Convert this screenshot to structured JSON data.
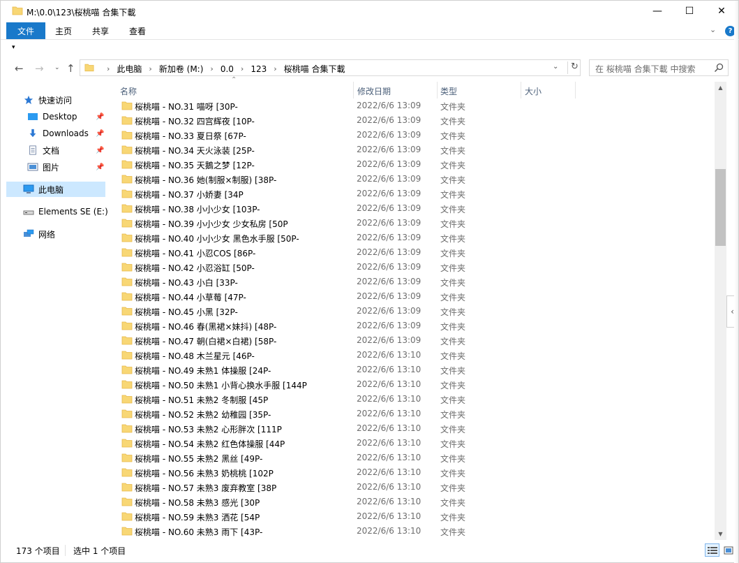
{
  "window": {
    "title": "M:\\0.0\\123\\桜桃喵 合集下載",
    "minimize": "—",
    "maximize": "☐",
    "close": "✕"
  },
  "ribbon": {
    "tabs": [
      "文件",
      "主页",
      "共享",
      "查看"
    ],
    "help": "?",
    "expand": "⌄"
  },
  "qat": {
    "customize": "▾"
  },
  "nav_buttons": {
    "back": "←",
    "forward": "→",
    "recent": "⌄",
    "up": "↑"
  },
  "address": {
    "crumbs": [
      "此电脑",
      "新加卷 (M:)",
      "0.0",
      "123",
      "桜桃喵 合集下載"
    ],
    "separator": "›",
    "dropdown": "⌄",
    "refresh": "↻"
  },
  "search": {
    "placeholder": "在 桜桃喵 合集下載 中搜索"
  },
  "navpane": {
    "quick_access": "快速访问",
    "desktop": "Desktop",
    "downloads": "Downloads",
    "documents": "文档",
    "pictures": "图片",
    "this_pc": "此电脑",
    "drive": "Elements SE (E:)",
    "network": "网络",
    "pin": "📌"
  },
  "columns": {
    "name": "名称",
    "date": "修改日期",
    "type": "类型",
    "size": "大小",
    "sort_indicator": "⌃"
  },
  "files": [
    {
      "name": "桜桃喵 - NO.31 喵呀 [30P-",
      "date": "2022/6/6 13:09",
      "type": "文件夹"
    },
    {
      "name": "桜桃喵 - NO.32 四宫辉夜 [10P-",
      "date": "2022/6/6 13:09",
      "type": "文件夹"
    },
    {
      "name": "桜桃喵 - NO.33 夏日祭 [67P-",
      "date": "2022/6/6 13:09",
      "type": "文件夹"
    },
    {
      "name": "桜桃喵 - NO.34 天火泳装 [25P-",
      "date": "2022/6/6 13:09",
      "type": "文件夹"
    },
    {
      "name": "桜桃喵 - NO.35 天鵝之梦 [12P-",
      "date": "2022/6/6 13:09",
      "type": "文件夹"
    },
    {
      "name": "桜桃喵 - NO.36 她(制服×制服) [38P-",
      "date": "2022/6/6 13:09",
      "type": "文件夹"
    },
    {
      "name": "桜桃喵 - NO.37 小娇妻 [34P",
      "date": "2022/6/6 13:09",
      "type": "文件夹"
    },
    {
      "name": "桜桃喵 - NO.38 小小少女 [103P-",
      "date": "2022/6/6 13:09",
      "type": "文件夹"
    },
    {
      "name": "桜桃喵 - NO.39 小小少女 少女私房 [50P",
      "date": "2022/6/6 13:09",
      "type": "文件夹"
    },
    {
      "name": "桜桃喵 - NO.40 小小少女 黑色水手服 [50P-",
      "date": "2022/6/6 13:09",
      "type": "文件夹"
    },
    {
      "name": "桜桃喵 - NO.41 小忍COS [86P-",
      "date": "2022/6/6 13:09",
      "type": "文件夹"
    },
    {
      "name": "桜桃喵 - NO.42 小忍浴缸 [50P-",
      "date": "2022/6/6 13:09",
      "type": "文件夹"
    },
    {
      "name": "桜桃喵 - NO.43 小白 [33P-",
      "date": "2022/6/6 13:09",
      "type": "文件夹"
    },
    {
      "name": "桜桃喵 - NO.44 小草莓 [47P-",
      "date": "2022/6/6 13:09",
      "type": "文件夹"
    },
    {
      "name": "桜桃喵 - NO.45 小黑 [32P-",
      "date": "2022/6/6 13:09",
      "type": "文件夹"
    },
    {
      "name": "桜桃喵 - NO.46 春(黑裙×妹抖) [48P-",
      "date": "2022/6/6 13:09",
      "type": "文件夹"
    },
    {
      "name": "桜桃喵 - NO.47 朝(白裙×白裙) [58P-",
      "date": "2022/6/6 13:09",
      "type": "文件夹"
    },
    {
      "name": "桜桃喵 - NO.48 木兰星元 [46P-",
      "date": "2022/6/6 13:10",
      "type": "文件夹"
    },
    {
      "name": "桜桃喵 - NO.49 未熟1 体操服 [24P-",
      "date": "2022/6/6 13:10",
      "type": "文件夹"
    },
    {
      "name": "桜桃喵 - NO.50 未熟1 小背心换水手服 [144P",
      "date": "2022/6/6 13:10",
      "type": "文件夹"
    },
    {
      "name": "桜桃喵 - NO.51 未熟2 冬制服 [45P",
      "date": "2022/6/6 13:10",
      "type": "文件夹"
    },
    {
      "name": "桜桃喵 - NO.52 未熟2 幼稚园 [35P-",
      "date": "2022/6/6 13:10",
      "type": "文件夹"
    },
    {
      "name": "桜桃喵 - NO.53 未熟2 心形胖次 [111P",
      "date": "2022/6/6 13:10",
      "type": "文件夹"
    },
    {
      "name": "桜桃喵 - NO.54 未熟2 红色体操服 [44P",
      "date": "2022/6/6 13:10",
      "type": "文件夹"
    },
    {
      "name": "桜桃喵 - NO.55 未熟2 黑丝 [49P-",
      "date": "2022/6/6 13:10",
      "type": "文件夹"
    },
    {
      "name": "桜桃喵 - NO.56 未熟3 奶桃桃 [102P",
      "date": "2022/6/6 13:10",
      "type": "文件夹"
    },
    {
      "name": "桜桃喵 - NO.57 未熟3 废弃教室 [38P",
      "date": "2022/6/6 13:10",
      "type": "文件夹"
    },
    {
      "name": "桜桃喵 - NO.58 未熟3 感光 [30P",
      "date": "2022/6/6 13:10",
      "type": "文件夹"
    },
    {
      "name": "桜桃喵 - NO.59 未熟3 洒花 [54P",
      "date": "2022/6/6 13:10",
      "type": "文件夹"
    },
    {
      "name": "桜桃喵 - NO.60 未熟3 雨下 [43P-",
      "date": "2022/6/6 13:10",
      "type": "文件夹"
    }
  ],
  "scrollbar": {
    "up": "▲",
    "down": "▼"
  },
  "preview_toggle": "‹",
  "status": {
    "count": "173 个项目",
    "selected": "选中 1 个项目"
  },
  "colors": {
    "accent": "#1979ca",
    "selected_bg": "#cce8ff",
    "folder": "#f8d775",
    "folder_dark": "#e6b84a"
  }
}
